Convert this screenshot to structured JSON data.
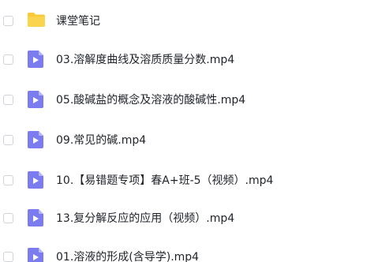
{
  "files": [
    {
      "name": "课堂笔记",
      "type": "folder"
    },
    {
      "name": "03.溶解度曲线及溶质质量分数.mp4",
      "type": "video"
    },
    {
      "name": "05.酸碱盐的概念及溶液的酸碱性.mp4",
      "type": "video"
    },
    {
      "name": "09.常见的碱.mp4",
      "type": "video"
    },
    {
      "name": "10.【易错题专项】春A+班-5（视频）.mp4",
      "type": "video"
    },
    {
      "name": "13.复分解反应的应用（视频）.mp4",
      "type": "video"
    },
    {
      "name": "01.溶液的形成(含导学).mp4",
      "type": "video"
    }
  ],
  "colors": {
    "folder": "#f9c937",
    "video": "#7b7cf0",
    "video_fold": "#b6b7f7",
    "text": "#1f2329",
    "checkbox_border": "#cfd3da"
  },
  "icons": {
    "folder": "folder-icon",
    "video": "video-file-icon"
  }
}
